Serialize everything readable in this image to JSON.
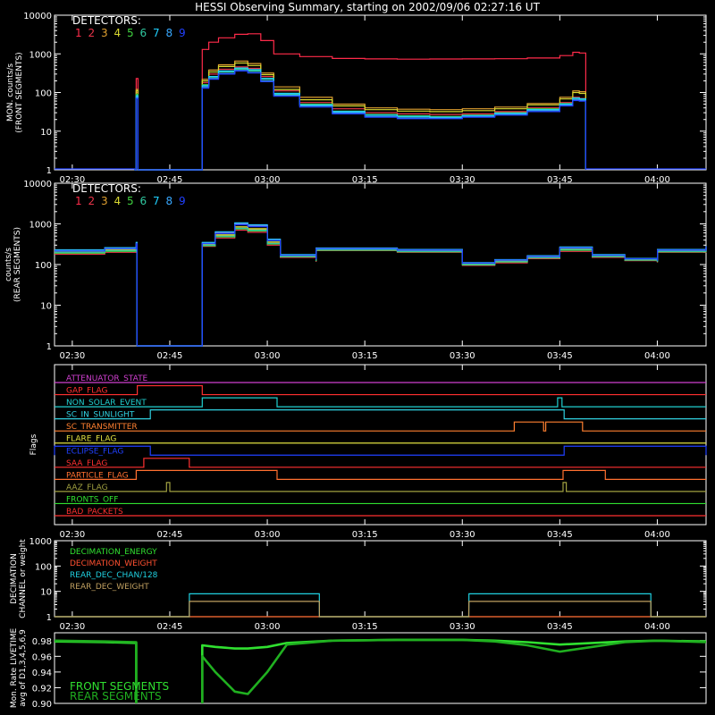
{
  "title": "HESSI Observing Summary, starting on 2002/09/06 02:27:16 UT",
  "colors": {
    "background": "#000000",
    "axes": "#ffffff",
    "detectors": [
      "#ff2b4a",
      "#e8354a",
      "#e0a030",
      "#d8d830",
      "#40d040",
      "#30c8a0",
      "#20d0ff",
      "#38a8ff",
      "#2040ff"
    ]
  },
  "time_axis": {
    "start": "02:27:16",
    "end": "04:07:30",
    "ticks": [
      "02:30",
      "02:45",
      "03:00",
      "03:15",
      "03:30",
      "03:45",
      "04:00"
    ]
  },
  "chart_data": [
    {
      "type": "line",
      "scale": "log",
      "ylabel": "MON. counts/s (FRONT SEGMENTS)",
      "ylabel_lines": [
        "MON. counts/s",
        "(FRONT SEGMENTS)"
      ],
      "ylim": [
        1,
        10000
      ],
      "yticks": [
        "1",
        "10",
        "100",
        "1000",
        "10000"
      ],
      "legend_title": "DETECTORS:",
      "legend_labels": [
        "1",
        "2",
        "3",
        "4",
        "5",
        "6",
        "7",
        "8",
        "9"
      ],
      "data_gap": [
        "02:40:00",
        "02:50:00"
      ],
      "times": [
        "02:39:50",
        "02:50:00",
        "02:51:00",
        "02:52:30",
        "02:55:00",
        "02:57:00",
        "02:59:00",
        "03:01:00",
        "03:05:00",
        "03:10:00",
        "03:15:00",
        "03:20:00",
        "03:25:00",
        "03:30:00",
        "03:35:00",
        "03:40:00",
        "03:45:00",
        "03:47:00",
        "03:48:00"
      ],
      "series": [
        {
          "name": "1",
          "values": [
            230,
            1300,
            2000,
            2600,
            3200,
            3300,
            2200,
            1000,
            850,
            760,
            740,
            730,
            735,
            740,
            750,
            780,
            900,
            1100,
            1050
          ]
        },
        {
          "name": "2",
          "values": [
            100,
            180,
            300,
            400,
            460,
            420,
            260,
            110,
            55,
            38,
            30,
            28,
            27,
            28,
            32,
            40,
            55,
            75,
            70
          ]
        },
        {
          "name": "3",
          "values": [
            120,
            220,
            380,
            520,
            650,
            560,
            320,
            140,
            75,
            50,
            40,
            37,
            36,
            38,
            42,
            52,
            75,
            110,
            105
          ]
        },
        {
          "name": "4",
          "values": [
            110,
            200,
            340,
            470,
            580,
            500,
            290,
            120,
            65,
            45,
            36,
            33,
            32,
            34,
            38,
            48,
            68,
            100,
            95
          ]
        },
        {
          "name": "5",
          "values": [
            90,
            160,
            260,
            350,
            420,
            380,
            230,
            95,
            50,
            33,
            27,
            25,
            24,
            26,
            30,
            38,
            52,
            72,
            68
          ]
        },
        {
          "name": "6",
          "values": [
            85,
            150,
            250,
            340,
            400,
            360,
            220,
            90,
            48,
            32,
            26,
            24,
            23,
            25,
            29,
            36,
            50,
            70,
            66
          ]
        },
        {
          "name": "7",
          "values": [
            80,
            150,
            260,
            360,
            430,
            390,
            230,
            95,
            48,
            32,
            26,
            24,
            23,
            25,
            29,
            36,
            50,
            72,
            68
          ]
        },
        {
          "name": "8",
          "values": [
            75,
            140,
            230,
            310,
            370,
            330,
            200,
            85,
            45,
            30,
            24,
            22,
            22,
            24,
            27,
            34,
            47,
            66,
            62
          ]
        },
        {
          "name": "9",
          "values": [
            70,
            130,
            220,
            300,
            360,
            320,
            190,
            80,
            42,
            28,
            23,
            21,
            21,
            23,
            26,
            32,
            45,
            62,
            60
          ]
        }
      ]
    },
    {
      "type": "line",
      "scale": "log",
      "ylabel": "counts/s (REAR SEGMENTS)",
      "ylabel_lines": [
        "counts/s",
        "(REAR SEGMENTS)"
      ],
      "ylim": [
        1,
        10000
      ],
      "yticks": [
        "1",
        "10",
        "100",
        "1000",
        "10000"
      ],
      "legend_title": "DETECTORS:",
      "legend_labels": [
        "1",
        "2",
        "3",
        "4",
        "5",
        "6",
        "7",
        "8",
        "9"
      ],
      "data_gap": [
        "02:40:00",
        "02:50:00"
      ],
      "times": [
        "02:27:16",
        "02:35:00",
        "02:39:50",
        "02:50:00",
        "02:52:00",
        "02:55:00",
        "02:57:00",
        "03:00:00",
        "03:02:00",
        "03:07:30",
        "03:07:31",
        "03:20:00",
        "03:30:00",
        "03:30:01",
        "03:35:00",
        "03:40:00",
        "03:45:00",
        "03:50:00",
        "03:55:00",
        "04:00:00",
        "04:00:01",
        "04:07:30"
      ],
      "series": [
        {
          "name": "1",
          "values": [
            220,
            250,
            330,
            330,
            600,
            1000,
            900,
            400,
            170,
            140,
            250,
            230,
            210,
            110,
            130,
            160,
            260,
            170,
            140,
            130,
            230,
            280
          ]
        },
        {
          "name": "2",
          "values": [
            180,
            200,
            280,
            280,
            450,
            700,
            620,
            300,
            150,
            120,
            220,
            200,
            180,
            95,
            110,
            140,
            210,
            150,
            125,
            115,
            200,
            240
          ]
        },
        {
          "name": "3",
          "values": [
            200,
            225,
            300,
            300,
            520,
            800,
            720,
            340,
            160,
            130,
            235,
            215,
            195,
            100,
            120,
            150,
            240,
            160,
            130,
            122,
            215,
            260
          ]
        },
        {
          "name": "4",
          "values": [
            210,
            235,
            310,
            310,
            540,
            850,
            760,
            360,
            165,
            135,
            240,
            220,
            200,
            105,
            125,
            155,
            250,
            165,
            135,
            125,
            220,
            265
          ]
        },
        {
          "name": "5",
          "values": [
            190,
            210,
            290,
            290,
            480,
            750,
            670,
            320,
            155,
            125,
            225,
            205,
            185,
            98,
            115,
            145,
            225,
            155,
            128,
            118,
            205,
            245
          ]
        },
        {
          "name": "6",
          "values": [
            200,
            220,
            300,
            300,
            500,
            780,
            700,
            330,
            158,
            128,
            230,
            210,
            190,
            100,
            118,
            148,
            235,
            158,
            130,
            120,
            210,
            255
          ]
        },
        {
          "name": "7",
          "values": [
            230,
            260,
            350,
            350,
            640,
            1060,
            950,
            420,
            175,
            145,
            255,
            235,
            215,
            112,
            132,
            165,
            270,
            175,
            142,
            132,
            235,
            285
          ]
        },
        {
          "name": "8",
          "values": [
            225,
            255,
            340,
            340,
            620,
            1020,
            920,
            410,
            172,
            142,
            252,
            232,
            212,
            110,
            130,
            162,
            265,
            172,
            140,
            130,
            232,
            282
          ]
        },
        {
          "name": "9",
          "values": [
            215,
            245,
            325,
            325,
            580,
            950,
            860,
            390,
            168,
            138,
            245,
            225,
            205,
            108,
            128,
            158,
            255,
            168,
            138,
            128,
            225,
            275
          ]
        }
      ]
    },
    {
      "type": "line",
      "ylabel": "Flags",
      "flags": [
        {
          "name": "ATTENUATOR_STATE",
          "color": "#d040d0",
          "intervals": []
        },
        {
          "name": "GAP_FLAG",
          "color": "#ff3030",
          "intervals": [
            [
              "02:40:00",
              "02:50:00"
            ]
          ]
        },
        {
          "name": "NON_SOLAR_EVENT",
          "color": "#20d0d0",
          "intervals": [
            [
              "02:50:00",
              "03:01:30"
            ],
            [
              "03:44:40",
              "03:45:20"
            ]
          ]
        },
        {
          "name": "SC_IN_SUNLIGHT",
          "color": "#30d0e0",
          "intervals": [
            [
              "02:42:00",
              "03:45:40"
            ]
          ]
        },
        {
          "name": "SC_TRANSMITTER",
          "color": "#ff8030",
          "intervals": [
            [
              "03:38:00",
              "03:42:30"
            ],
            [
              "03:42:50",
              "03:48:30"
            ]
          ]
        },
        {
          "name": "FLARE_FLAG",
          "color": "#e0e040",
          "intervals": []
        },
        {
          "name": "ECLIPSE_FLAG",
          "color": "#2040ff",
          "intervals": [
            [
              "02:27:16",
              "02:42:00"
            ],
            [
              "03:45:40",
              "04:07:30"
            ]
          ]
        },
        {
          "name": "SAA_FLAG",
          "color": "#ff3030",
          "intervals": [
            [
              "02:41:00",
              "02:48:00"
            ]
          ]
        },
        {
          "name": "PARTICLE_FLAG",
          "color": "#ff7030",
          "intervals": [
            [
              "02:39:50",
              "03:01:30"
            ],
            [
              "03:45:30",
              "03:52:00"
            ]
          ]
        },
        {
          "name": "AAZ_FLAG",
          "color": "#a0a040",
          "intervals": [
            [
              "02:44:30",
              "02:45:00"
            ],
            [
              "03:45:30",
              "03:46:00"
            ]
          ]
        },
        {
          "name": "FRONTS_OFF",
          "color": "#30e030",
          "intervals": []
        },
        {
          "name": "BAD_PACKETS",
          "color": "#ff3030",
          "intervals": []
        }
      ]
    },
    {
      "type": "line",
      "scale": "log",
      "ylabel": "DECIMATION CHANNEL or weight",
      "ylabel_lines": [
        "DECIMATION",
        "CHANNEL or weight"
      ],
      "ylim": [
        1,
        1000
      ],
      "yticks": [
        "1",
        "10",
        "100",
        "1000"
      ],
      "legend": [
        "DECIMATION_ENERGY",
        "DECIMATION_WEIGHT",
        "REAR_DEC_CHAN/128",
        "REAR_DEC_WEIGHT"
      ],
      "legend_colors": [
        "#30e030",
        "#ff5030",
        "#20d0e0",
        "#c0a060"
      ],
      "series": [
        {
          "name": "DECIMATION_ENERGY",
          "times": [
            "02:27:16",
            "04:07:30"
          ],
          "values": [
            1,
            1
          ]
        },
        {
          "name": "DECIMATION_WEIGHT",
          "times": [
            "02:27:16",
            "04:07:30"
          ],
          "values": [
            1,
            1
          ]
        },
        {
          "name": "REAR_DEC_CHAN/128",
          "times": [
            "02:27:16",
            "02:48:00",
            "02:48:01",
            "03:08:00",
            "03:08:01",
            "03:31:00",
            "03:31:01",
            "03:59:00",
            "03:59:01",
            "04:07:30"
          ],
          "values": [
            1,
            1,
            8,
            8,
            1,
            1,
            8,
            8,
            1,
            1
          ]
        },
        {
          "name": "REAR_DEC_WEIGHT",
          "times": [
            "02:27:16",
            "02:48:00",
            "02:48:01",
            "03:08:00",
            "03:08:01",
            "03:31:00",
            "03:31:01",
            "03:59:00",
            "03:59:01",
            "04:07:30"
          ],
          "values": [
            1,
            1,
            4,
            4,
            1,
            1,
            4,
            4,
            1,
            1
          ]
        }
      ]
    },
    {
      "type": "line",
      "ylabel": "Mon. Rate LIVETIME avg of D1,3,4,5,6,9",
      "ylabel_lines": [
        "Mon. Rate LIVETIME",
        "avg of D1,3,4,5,6,9"
      ],
      "ylim": [
        0.9,
        0.99
      ],
      "yticks": [
        "0.90",
        "0.92",
        "0.94",
        "0.96",
        "0.98"
      ],
      "legend": [
        "FRONT SEGMENTS",
        "REAR SEGMENTS"
      ],
      "legend_colors": [
        "#30e030",
        "#20b020"
      ],
      "data_gap": [
        "02:39:50",
        "02:50:00"
      ],
      "series": [
        {
          "name": "FRONT SEGMENTS",
          "times": [
            "02:27:16",
            "02:35:00",
            "02:39:50",
            "02:50:00",
            "02:52:00",
            "02:55:00",
            "02:57:00",
            "03:00:00",
            "03:03:00",
            "03:10:00",
            "03:20:00",
            "03:30:00",
            "03:35:00",
            "03:40:00",
            "03:45:00",
            "03:50:00",
            "03:55:00",
            "04:00:00",
            "04:07:30"
          ],
          "values": [
            0.979,
            0.978,
            0.977,
            0.974,
            0.972,
            0.97,
            0.97,
            0.972,
            0.977,
            0.98,
            0.981,
            0.981,
            0.98,
            0.978,
            0.975,
            0.977,
            0.979,
            0.98,
            0.979
          ]
        },
        {
          "name": "REAR SEGMENTS",
          "times": [
            "02:27:16",
            "02:35:00",
            "02:39:50",
            "02:50:00",
            "02:52:00",
            "02:55:00",
            "02:57:00",
            "03:00:00",
            "03:03:00",
            "03:10:00",
            "03:20:00",
            "03:30:00",
            "03:35:00",
            "03:40:00",
            "03:45:00",
            "03:50:00",
            "03:55:00",
            "04:00:00",
            "04:07:30"
          ],
          "values": [
            0.98,
            0.979,
            0.978,
            0.96,
            0.94,
            0.915,
            0.912,
            0.94,
            0.975,
            0.98,
            0.981,
            0.981,
            0.979,
            0.974,
            0.966,
            0.972,
            0.978,
            0.98,
            0.978
          ]
        }
      ]
    }
  ]
}
